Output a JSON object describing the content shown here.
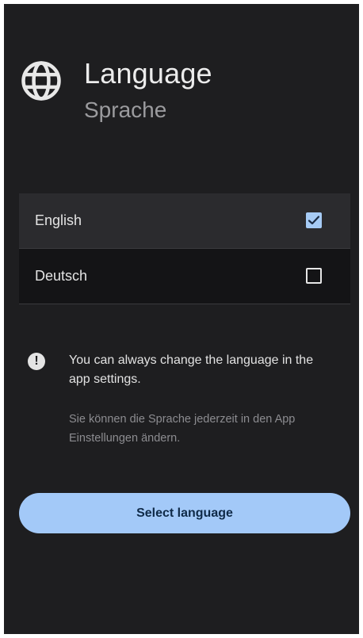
{
  "header": {
    "icon": "globe-icon",
    "title": "Language",
    "subtitle": "Sprache"
  },
  "languages": [
    {
      "label": "English",
      "selected": true,
      "icon": "checkbox-checked-icon"
    },
    {
      "label": "Deutsch",
      "selected": false,
      "icon": "checkbox-empty-icon"
    }
  ],
  "info": {
    "icon": "info-exclamation-icon",
    "text_en": "You can always change the language in the app settings.",
    "text_de": "Sie können die Sprache jederzeit in den App Einstellungen ändern."
  },
  "actions": {
    "select_label": "Select language"
  },
  "colors": {
    "background": "#1e1e20",
    "selected_row": "#2b2b2e",
    "unselected_row": "#141416",
    "accent": "#a3c9f8",
    "accent_text": "#0f2a48"
  }
}
